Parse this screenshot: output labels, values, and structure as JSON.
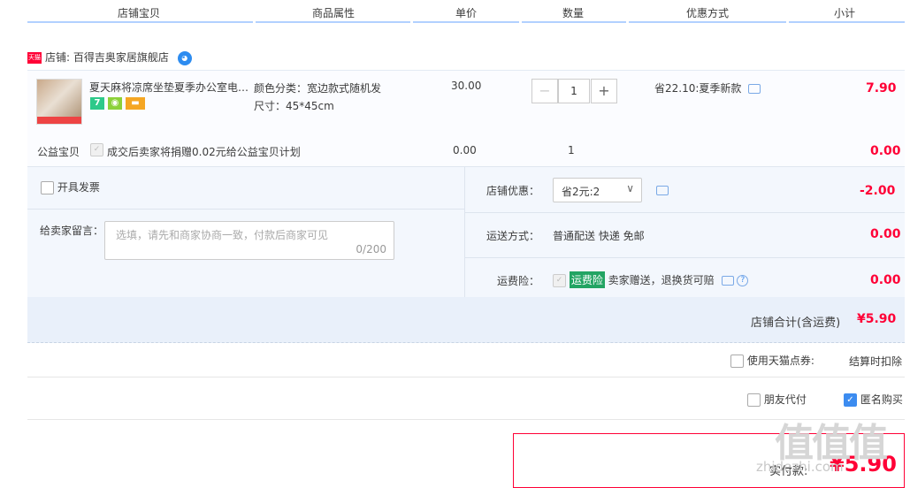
{
  "header": {
    "cols": [
      "店铺宝贝",
      "商品属性",
      "单价",
      "数量",
      "优惠方式",
      "小计"
    ]
  },
  "shop": {
    "badge": "天猫",
    "label": "店铺:",
    "name": "百得吉奥家居旗舰店"
  },
  "item": {
    "title": "夏天麻将凉席坐垫夏季办公室电…",
    "attr_color": "颜色分类：宽边款式随机发",
    "attr_size": "尺寸：45*45cm",
    "unit_price": "30.00",
    "quantity": "1",
    "promo": "省22.10:夏季新款",
    "subtotal": "7.90",
    "service_icons": [
      "seven-day-return-icon",
      "guarantee-icon",
      "credit-card-icon"
    ]
  },
  "charity": {
    "label": "公益宝贝",
    "desc": "成交后卖家将捐赠0.02元给公益宝贝计划",
    "price": "0.00",
    "quantity": "1",
    "subtotal": "0.00"
  },
  "options": {
    "invoice_label": "开具发票",
    "message_label": "给卖家留言：",
    "message_placeholder": "选填，请先和商家协商一致，付款后商家可见",
    "message_count": "0/200",
    "shop_discount_label": "店铺优惠：",
    "shop_discount_value": "省2元:2",
    "shop_discount_amount": "-2.00",
    "shipping_label": "运送方式：",
    "shipping_value": "普通配送 快递 免邮",
    "shipping_amount": "0.00",
    "insurance_label": "运费险：",
    "insurance_tag": "运费险",
    "insurance_desc": "卖家赠送，退换货可赔",
    "insurance_amount": "0.00"
  },
  "total": {
    "label": "店铺合计(含运费)",
    "value": "¥5.90"
  },
  "coupon": {
    "label": "使用天猫点券:",
    "note": "结算时扣除"
  },
  "extra": {
    "friend_pay": "朋友代付",
    "anonymous": "匿名购买"
  },
  "pay": {
    "label": "实付款:",
    "value": "¥5.90"
  },
  "watermark": {
    "text": "值值值",
    "sub": "zhidezhi.com"
  },
  "colors": {
    "price_red": "#ff0036",
    "accent_blue": "#3c8cf0",
    "insurance_green": "#23a463"
  }
}
